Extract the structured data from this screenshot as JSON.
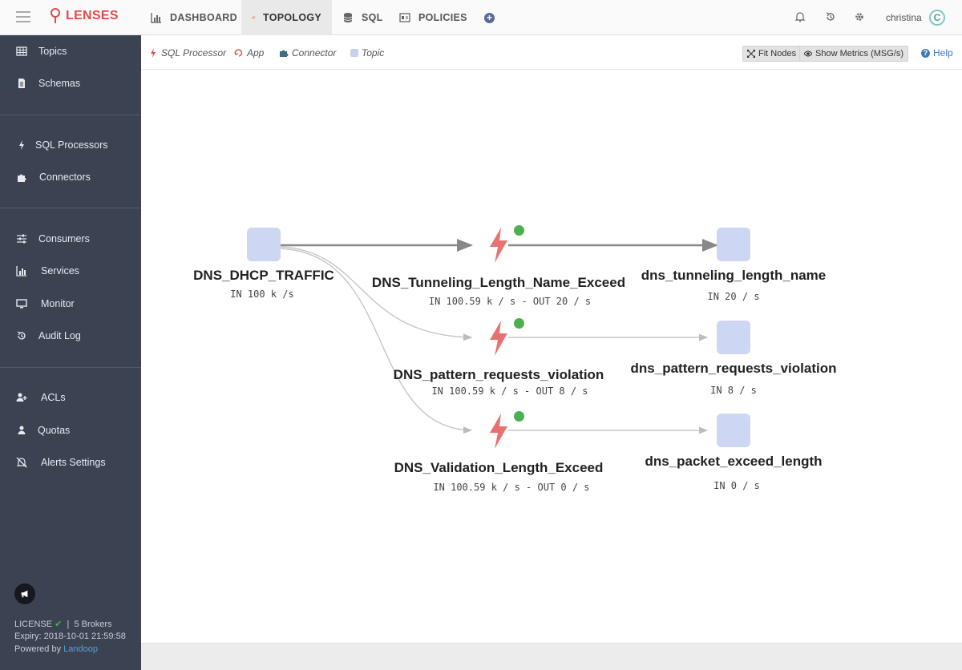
{
  "app": {
    "logo": "LENSES"
  },
  "nav": {
    "tabs": [
      {
        "label": "DASHBOARD"
      },
      {
        "label": "TOPOLOGY"
      },
      {
        "label": "SQL"
      },
      {
        "label": "POLICIES"
      }
    ],
    "add": "+",
    "user": "christina",
    "avatar_initial": "C"
  },
  "sidebar": {
    "items": [
      {
        "label": "Topics"
      },
      {
        "label": "Schemas"
      },
      {
        "label": "SQL Processors"
      },
      {
        "label": "Connectors"
      },
      {
        "label": "Consumers"
      },
      {
        "label": "Services"
      },
      {
        "label": "Monitor"
      },
      {
        "label": "Audit Log"
      },
      {
        "label": "ACLs"
      },
      {
        "label": "Quotas"
      },
      {
        "label": "Alerts Settings"
      }
    ],
    "license": {
      "label": "LICENSE",
      "check": "✔",
      "brokers": "5 Brokers",
      "expiry": "Expiry: 2018-10-01 21:59:58",
      "powered_prefix": "Powered by",
      "powered_link": "Landoop"
    }
  },
  "legend": {
    "sql_processor": "SQL Processor",
    "app": "App",
    "connector": "Connector",
    "topic": "Topic",
    "fit_nodes": "Fit Nodes",
    "show_metrics": "Show Metrics (MSG/s)",
    "help": "Help",
    "help_icon": "?"
  },
  "topology": {
    "source": {
      "name": "DNS_DHCP_TRAFFIC",
      "metric": "IN 100 k /s"
    },
    "processors": [
      {
        "name": "DNS_Tunneling_Length_Name_Exceed",
        "metric": "IN 100.59 k / s - OUT 20 / s"
      },
      {
        "name": "DNS_pattern_requests_violation",
        "metric": "IN 100.59 k / s - OUT 8 / s"
      },
      {
        "name": "DNS_Validation_Length_Exceed",
        "metric": "IN 100.59 k / s - OUT 0 / s"
      }
    ],
    "sinks": [
      {
        "name": "dns_tunneling_length_name",
        "metric": "IN 20 / s"
      },
      {
        "name": "dns_pattern_requests_violation",
        "metric": "IN 8 / s"
      },
      {
        "name": "dns_packet_exceed_length",
        "metric": "IN 0 / s"
      }
    ],
    "colors": {
      "processor": "#e87272",
      "topic": "#cdd7f3",
      "status": "#4caf50"
    }
  }
}
